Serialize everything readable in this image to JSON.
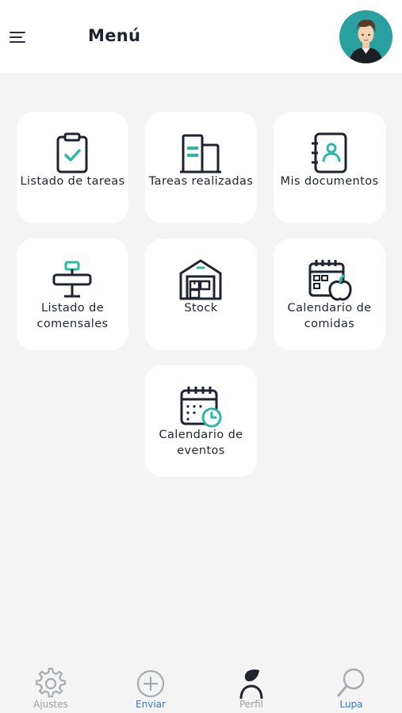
{
  "header": {
    "title": "Menú",
    "menu_icon": "hamburger-icon",
    "avatar": "user-avatar"
  },
  "tiles": [
    {
      "label": "Listado de tareas",
      "icon": "clipboard-check-icon"
    },
    {
      "label": "Tareas realizadas",
      "icon": "buildings-icon"
    },
    {
      "label": "Mis documentos",
      "icon": "contact-book-icon"
    },
    {
      "label": "Listado de\ncomensales",
      "icon": "signpost-icon"
    },
    {
      "label": "Stock",
      "icon": "warehouse-icon"
    },
    {
      "label": "Calendario de\ncomidas",
      "icon": "calendar-apple-icon"
    },
    {
      "label": "Calendario de\neventos",
      "icon": "calendar-clock-icon"
    }
  ],
  "bottom_nav": [
    {
      "label": "Ajustes",
      "icon": "gear-icon"
    },
    {
      "label": "Enviar",
      "icon": "plus-circle-icon"
    },
    {
      "label": "Perfil",
      "icon": "profile-icon"
    },
    {
      "label": "Lupa",
      "icon": "magnifier-icon"
    }
  ],
  "colors": {
    "accent_teal": "#2bb8a6",
    "icon_dark": "#1f2330",
    "nav_active_blue": "#2f7bd1",
    "background": "#f4f4f4"
  }
}
